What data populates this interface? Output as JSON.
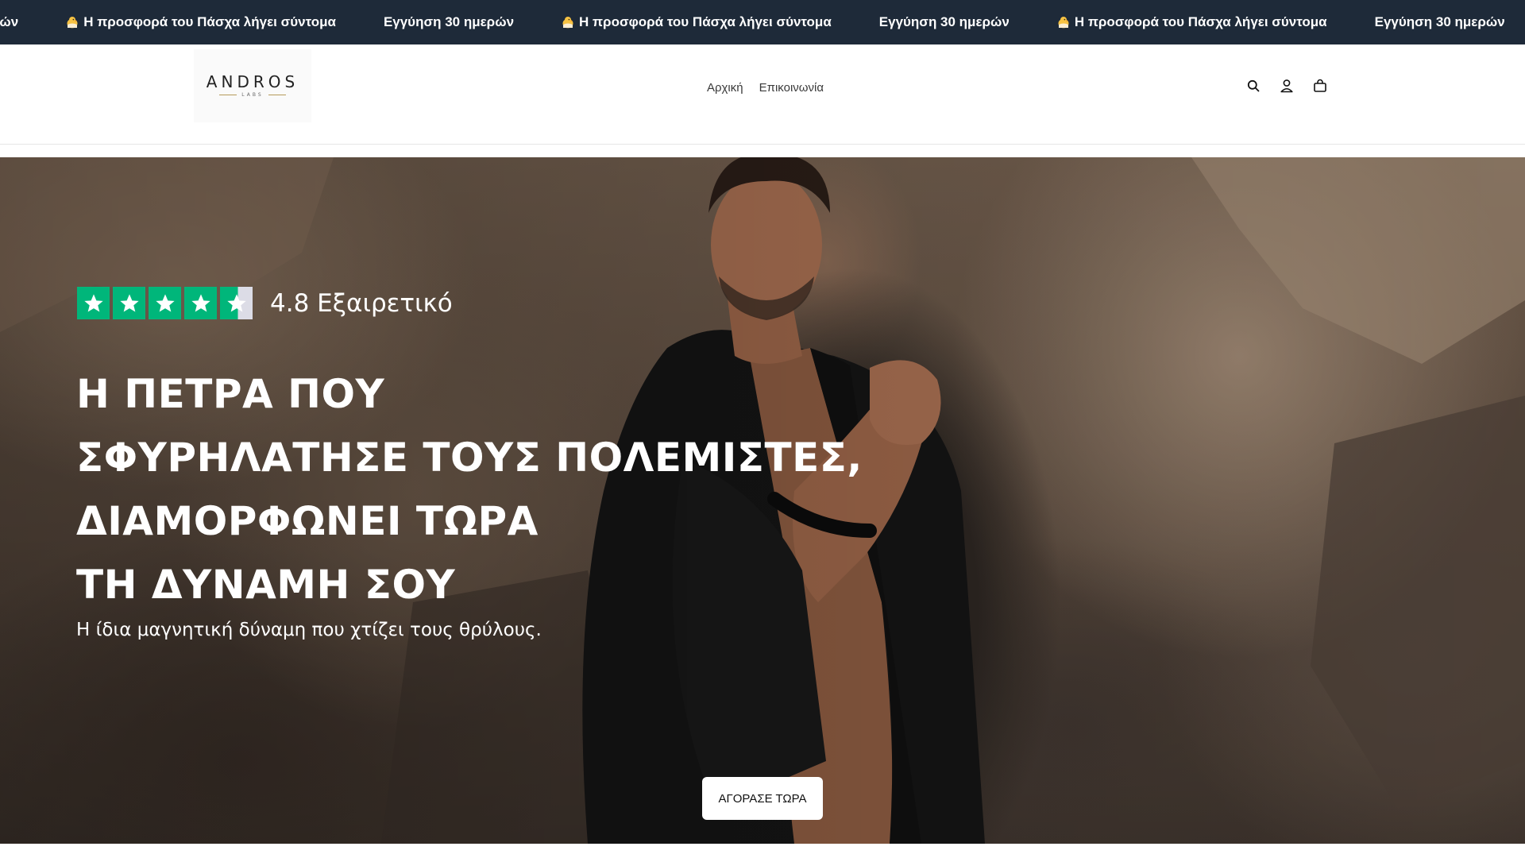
{
  "announcement": {
    "items": [
      {
        "emoji": "chick-icon",
        "text": "ημερών"
      },
      {
        "emoji": "chick-icon",
        "text": "Η προσφορά του Πάσχα λήγει σύντομα"
      },
      {
        "emoji": "",
        "text": "Εγγύηση 30 ημερών"
      },
      {
        "emoji": "chick-icon",
        "text": "Η προσφορά του Πάσχα λήγει σύντομα"
      },
      {
        "emoji": "",
        "text": "Εγγύηση 30 ημερών"
      },
      {
        "emoji": "chick-icon",
        "text": "Η προσφορά του Πάσχα λήγει σύντομα"
      },
      {
        "emoji": "",
        "text": "Εγγύηση 30 ημερών"
      }
    ],
    "background": "#1e2a39",
    "text_color": "#ffffff"
  },
  "header": {
    "logo": {
      "word": "ANDROS",
      "sub": "LABS"
    },
    "nav": [
      {
        "label": "Αρχική"
      },
      {
        "label": "Επικοινωνία"
      }
    ],
    "icons": [
      "search-icon",
      "account-icon",
      "cart-icon"
    ]
  },
  "hero": {
    "rating": {
      "value": 4.8,
      "stars_full": 4,
      "stars_partial": 0.55,
      "text": "4.8 Εξαιρετικό",
      "star_color": "#00b67a"
    },
    "headline_lines": [
      "Η ΠΕΤΡΑ ΠΟΥ",
      "ΣΦΥΡΗΛΑΤΗΣΕ ΤΟΥΣ ΠΟΛΕΜΙΣΤΕΣ,",
      "ΔΙΑΜΟΡΦΩΝΕΙ ΤΩΡΑ",
      "ΤΗ ΔΥΝΑΜΗ ΣΟΥ"
    ],
    "subheadline": "Η ίδια μαγνητική δύναμη που χτίζει τους θρύλους.",
    "cta_label": "ΑΓΟΡΑΣΕ ΤΩΡΑ"
  }
}
